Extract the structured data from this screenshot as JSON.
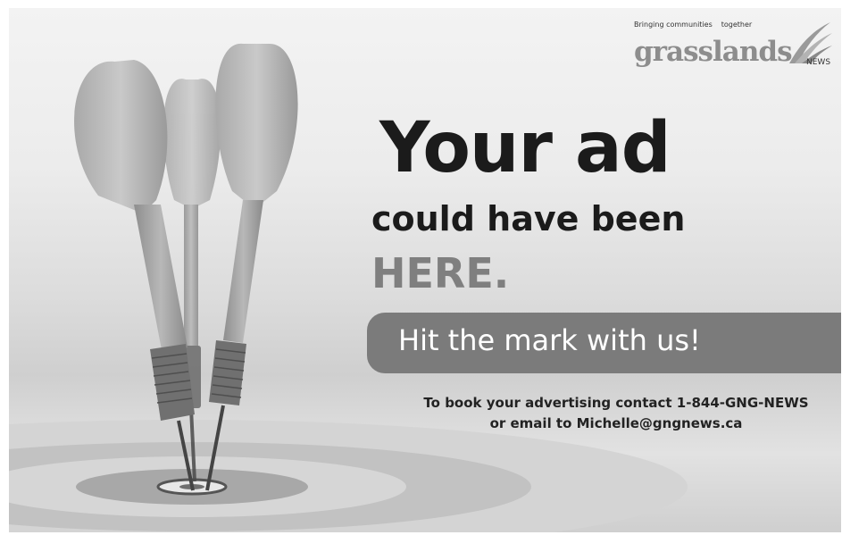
{
  "brand": {
    "tagline_left": "Bringing communities",
    "tagline_right": "together",
    "name": "grasslands",
    "suffix": "NEWS"
  },
  "headline": {
    "line1": "Your ad",
    "line2": "could have been",
    "line3": "HERE."
  },
  "banner": {
    "text": "Hit the mark with us!"
  },
  "contact": {
    "line1": "To book your advertising contact 1-844-GNG-NEWS",
    "line2": "or email to Michelle@gngnews.ca"
  },
  "colors": {
    "headline": "#1b1b1b",
    "accent_gray": "#7f7f7f",
    "banner_bg": "#7b7b7b",
    "banner_text": "#ffffff"
  }
}
